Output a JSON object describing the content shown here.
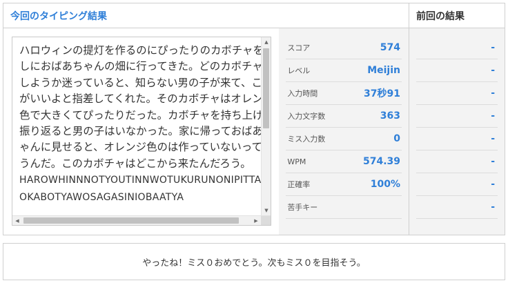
{
  "current": {
    "title": "今回のタイピング結果",
    "typed_text": "ハロウィンの提灯を作るのにぴったりのカボチャを探しにおばあちゃんの畑に行ってきた。どのカボチャにしようか迷っていると、知らない男の子が来て、これがいいよと指差してくれた。そのカボチャはオレンジ色で大きくてぴったりだった。カボチャを持ち上げて振り返ると男の子はいなかった。家に帰っておばあちゃんに見せると、オレンジ色のは作っていないって言うんだ。このカボチャはどこから来たんだろう。",
    "romaji_text": "HAROWHINNNOTYOUTINNWOTUKURUNONIPITTARINOKABOTYAWOSAGASINIOBAATYA",
    "stats": [
      {
        "label": "スコア",
        "value": "574"
      },
      {
        "label": "レベル",
        "value": "Meijin"
      },
      {
        "label": "入力時間",
        "value": "37秒91"
      },
      {
        "label": "入力文字数",
        "value": "363"
      },
      {
        "label": "ミス入力数",
        "value": "0"
      },
      {
        "label": "WPM",
        "value": "574.39"
      },
      {
        "label": "正確率",
        "value": "100%"
      },
      {
        "label": "苦手キー",
        "value": ""
      }
    ]
  },
  "previous": {
    "title": "前回の結果",
    "values": [
      "-",
      "-",
      "-",
      "-",
      "-",
      "-",
      "-",
      "-"
    ]
  },
  "message": "やったね！ミス０おめでとう。次もミス０を目指そう。",
  "colors": {
    "accent": "#2f7fd8",
    "panel_bg": "#f3f3f3",
    "border": "#cfcfcf"
  }
}
